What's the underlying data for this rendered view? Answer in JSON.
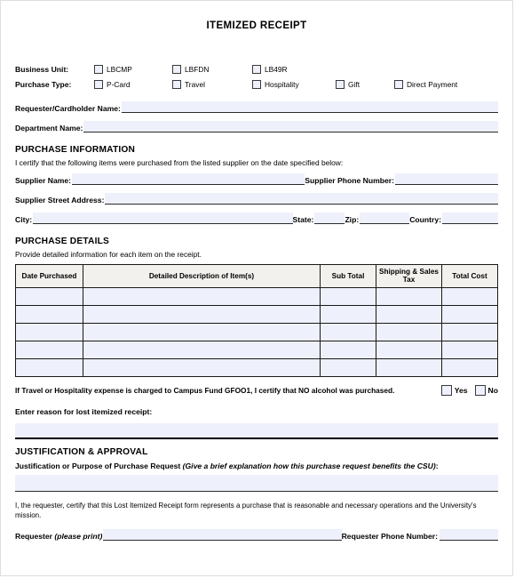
{
  "document": {
    "title": "ITEMIZED RECEIPT"
  },
  "business_unit": {
    "label": "Business Unit:",
    "options": [
      {
        "label": "LBCMP",
        "checked": false
      },
      {
        "label": "LBFDN",
        "checked": false
      },
      {
        "label": "LB49R",
        "checked": false
      }
    ]
  },
  "purchase_type": {
    "label": "Purchase Type:",
    "options": [
      {
        "label": "P-Card",
        "checked": false
      },
      {
        "label": "Travel",
        "checked": false
      },
      {
        "label": "Hospitality",
        "checked": false
      },
      {
        "label": "Gift",
        "checked": false
      },
      {
        "label": "Direct Payment",
        "checked": false
      }
    ]
  },
  "requester_fields": [
    {
      "label": "Requester/Cardholder Name:",
      "value": ""
    },
    {
      "label": "Department Name:",
      "value": ""
    }
  ],
  "purchase_information": {
    "heading": "PURCHASE INFORMATION",
    "certification": "I certify that the following items were purchased from the listed supplier on the date specified below:",
    "supplier_name_label": "Supplier Name:",
    "supplier_name_value": "",
    "supplier_phone_label": "Supplier Phone Number:",
    "supplier_phone_value": "",
    "supplier_address_label": "Supplier Street Address:",
    "supplier_address_value": "",
    "city_label": "City:",
    "city_value": "",
    "state_label": "State:",
    "state_value": "",
    "zip_label": "Zip:",
    "zip_value": "",
    "country_label": "Country:",
    "country_value": ""
  },
  "purchase_details": {
    "heading": "PURCHASE DETAILS",
    "instruction": "Provide detailed information for each item on the receipt.",
    "columns": [
      "Date Purchased",
      "Detailed Description of Item(s)",
      "Sub Total",
      "Shipping & Sales Tax",
      "Total Cost"
    ],
    "rows": [
      {
        "date": "",
        "description": "",
        "sub_total": "",
        "shipping_tax": "",
        "total_cost": ""
      },
      {
        "date": "",
        "description": "",
        "sub_total": "",
        "shipping_tax": "",
        "total_cost": ""
      },
      {
        "date": "",
        "description": "",
        "sub_total": "",
        "shipping_tax": "",
        "total_cost": ""
      },
      {
        "date": "",
        "description": "",
        "sub_total": "",
        "shipping_tax": "",
        "total_cost": ""
      },
      {
        "date": "",
        "description": "",
        "sub_total": "",
        "shipping_tax": "",
        "total_cost": ""
      }
    ]
  },
  "alcohol_certification": {
    "text": "If Travel or Hospitality expense is charged to Campus Fund GFOO1, I certify that NO alcohol was purchased.",
    "yes_label": "Yes",
    "no_label": "No",
    "yes_checked": false,
    "no_checked": false
  },
  "lost_receipt": {
    "label": "Enter reason for lost itemized receipt:",
    "value": ""
  },
  "justification": {
    "heading": "JUSTIFICATION & APPROVAL",
    "prompt_bold": "Justification or Purpose of Purchase Request",
    "prompt_italic": "(Give a brief explanation how this purchase request benefits the CSU)",
    "prompt_suffix": ":",
    "value": "",
    "attestation": "I, the requester, certify that this Lost Itemized Receipt form represents a purchase that is reasonable and necessary operations and the University's mission.",
    "requester_label_bold": "Requester",
    "requester_label_italic": "(please print)",
    "requester_value": "",
    "phone_label": "Requester Phone Number:",
    "phone_value": ""
  },
  "colors": {
    "field_fill": "#eef0fb",
    "table_header_fill": "#f2f1ee",
    "border": "#1a1a1a",
    "page_border": "#dedede"
  }
}
